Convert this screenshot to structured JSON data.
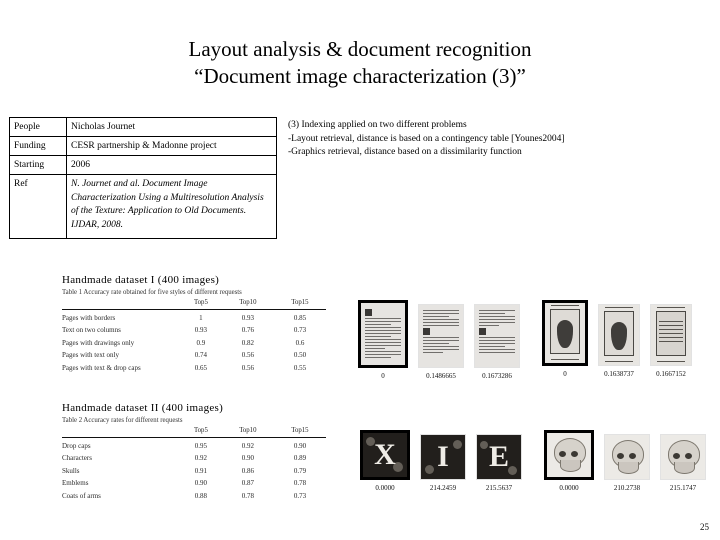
{
  "title": {
    "line1": "Layout analysis & document recognition",
    "line2": "“Document image characterization (3)”"
  },
  "info_table": {
    "rows": [
      {
        "key": "People",
        "value": "Nicholas Journet"
      },
      {
        "key": "Funding",
        "value": "CESR partnership & Madonne project"
      },
      {
        "key": "Starting",
        "value": "2006"
      },
      {
        "key": "Ref",
        "value": "N. Journet and al. Document Image Characterization Using a Multiresolution Analysis of the Texture: Application to Old Documents. IJDAR, 2008."
      }
    ]
  },
  "points": {
    "heading": "(3) Indexing applied on two different problems",
    "bullet1": "-Layout retrieval,  distance is based on a contingency table [Younes2004]",
    "bullet2": "-Graphics retrieval, distance based on a dissimilarity function"
  },
  "dataset1": {
    "heading": "Handmade dataset I (400 images)",
    "caption": "Table 1  Accuracy rate obtained for five styles of different requests",
    "columns": [
      "",
      "Top5",
      "Top10",
      "Top15"
    ],
    "rows": [
      {
        "label": "Pages with borders",
        "top5": "1",
        "top10": "0.93",
        "top15": "0.85"
      },
      {
        "label": "Text on two columns",
        "top5": "0.93",
        "top10": "0.76",
        "top15": "0.73"
      },
      {
        "label": "Pages with drawings only",
        "top5": "0.9",
        "top10": "0.82",
        "top15": "0.6"
      },
      {
        "label": "Pages with text only",
        "top5": "0.74",
        "top10": "0.56",
        "top15": "0.50"
      },
      {
        "label": "Pages with text & drop caps",
        "top5": "0.65",
        "top10": "0.56",
        "top15": "0.55"
      }
    ]
  },
  "dataset2": {
    "heading": "Handmade dataset II (400 images)",
    "caption": "Table 2  Accuracy rates for different requests",
    "columns": [
      "",
      "Top5",
      "Top10",
      "Top15"
    ],
    "rows": [
      {
        "label": "Drop caps",
        "top5": "0.95",
        "top10": "0.92",
        "top15": "0.90"
      },
      {
        "label": "Characters",
        "top5": "0.92",
        "top10": "0.90",
        "top15": "0.89"
      },
      {
        "label": "Skulls",
        "top5": "0.91",
        "top10": "0.86",
        "top15": "0.79"
      },
      {
        "label": "Emblems",
        "top5": "0.90",
        "top10": "0.87",
        "top15": "0.78"
      },
      {
        "label": "Coats of arms",
        "top5": "0.88",
        "top10": "0.78",
        "top15": "0.73"
      }
    ]
  },
  "retrieval_top": {
    "group1": {
      "labels": [
        "0",
        "0.1486665",
        "0.1673286"
      ],
      "icons": [
        "document-page-query-thumbnail",
        "document-page-result-thumbnail",
        "document-page-result-thumbnail"
      ]
    },
    "group2": {
      "labels": [
        "0",
        "0.1638737",
        "0.1667152"
      ],
      "icons": [
        "illustrated-page-query-thumbnail",
        "illustrated-page-result-thumbnail",
        "illustrated-page-result-thumbnail"
      ]
    }
  },
  "retrieval_bottom": {
    "group1": {
      "labels": [
        "0.0000",
        "214.2459",
        "215.5637"
      ],
      "letters": [
        "X",
        "I",
        "E"
      ],
      "icons": [
        "drop-cap-query-thumbnail",
        "drop-cap-result-thumbnail",
        "drop-cap-result-thumbnail"
      ]
    },
    "group2": {
      "labels": [
        "0.0000",
        "210.2738",
        "215.1747"
      ],
      "icons": [
        "skull-query-thumbnail",
        "skull-result-thumbnail",
        "skull-result-thumbnail"
      ]
    }
  },
  "page_number": "25"
}
